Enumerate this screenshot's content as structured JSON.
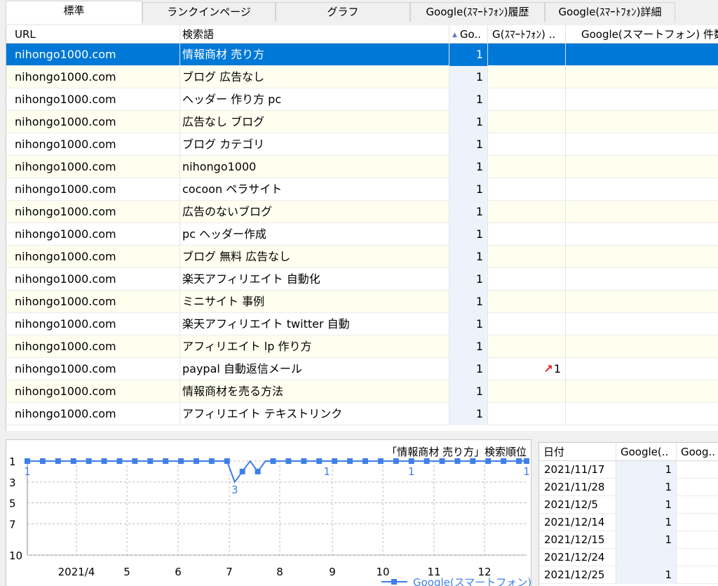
{
  "tabs": [
    {
      "label": "標準",
      "active": true
    },
    {
      "label": "ランクインページ",
      "active": false
    },
    {
      "label": "グラフ",
      "active": false
    },
    {
      "label": "Google(ｽﾏｰﾄﾌｫﾝ)履歴",
      "active": false
    },
    {
      "label": "Google(ｽﾏｰﾄﾌｫﾝ)詳細",
      "active": false
    }
  ],
  "grid": {
    "headers": {
      "url": "URL",
      "keyword": "検索語",
      "google": "Go..",
      "google_sp": "G(ｽﾏｰﾄﾌｫﾝ) ..",
      "count": "Google(スマートフォン) 件数"
    },
    "rows": [
      {
        "url": "nihongo1000.com",
        "keyword": "情報商材 売り方",
        "rank": "1",
        "sp": "",
        "up": false
      },
      {
        "url": "nihongo1000.com",
        "keyword": "ブログ 広告なし",
        "rank": "1",
        "sp": "",
        "up": false
      },
      {
        "url": "nihongo1000.com",
        "keyword": "ヘッダー 作り方 pc",
        "rank": "1",
        "sp": "",
        "up": false
      },
      {
        "url": "nihongo1000.com",
        "keyword": "広告なし ブログ",
        "rank": "1",
        "sp": "",
        "up": false
      },
      {
        "url": "nihongo1000.com",
        "keyword": "ブログ カテゴリ",
        "rank": "1",
        "sp": "",
        "up": false
      },
      {
        "url": "nihongo1000.com",
        "keyword": "nihongo1000",
        "rank": "1",
        "sp": "",
        "up": false
      },
      {
        "url": "nihongo1000.com",
        "keyword": "cocoon ペラサイト",
        "rank": "1",
        "sp": "",
        "up": false
      },
      {
        "url": "nihongo1000.com",
        "keyword": "広告のないブログ",
        "rank": "1",
        "sp": "",
        "up": false
      },
      {
        "url": "nihongo1000.com",
        "keyword": "pc ヘッダー作成",
        "rank": "1",
        "sp": "",
        "up": false
      },
      {
        "url": "nihongo1000.com",
        "keyword": "ブログ 無料 広告なし",
        "rank": "1",
        "sp": "",
        "up": false
      },
      {
        "url": "nihongo1000.com",
        "keyword": "楽天アフィリエイト 自動化",
        "rank": "1",
        "sp": "",
        "up": false
      },
      {
        "url": "nihongo1000.com",
        "keyword": "ミニサイト 事例",
        "rank": "1",
        "sp": "",
        "up": false
      },
      {
        "url": "nihongo1000.com",
        "keyword": "楽天アフィリエイト twitter 自動",
        "rank": "1",
        "sp": "",
        "up": false
      },
      {
        "url": "nihongo1000.com",
        "keyword": "アフィリエイト lp 作り方",
        "rank": "1",
        "sp": "",
        "up": false
      },
      {
        "url": "nihongo1000.com",
        "keyword": "paypal 自動返信メール",
        "rank": "1",
        "sp": "1",
        "up": true
      },
      {
        "url": "nihongo1000.com",
        "keyword": "情報商材を売る方法",
        "rank": "1",
        "sp": "",
        "up": false
      },
      {
        "url": "nihongo1000.com",
        "keyword": "アフィリエイト テキストリンク",
        "rank": "1",
        "sp": "",
        "up": false
      }
    ]
  },
  "chart_data": {
    "type": "line",
    "title": "「情報商材 売り方」検索順位",
    "x_tick_labels": [
      "2021/4",
      "5",
      "6",
      "7",
      "8",
      "9",
      "10",
      "11",
      "12"
    ],
    "y_tick_labels": [
      "1",
      "3",
      "5",
      "7",
      "10"
    ],
    "ylim": [
      10,
      1
    ],
    "series": [
      {
        "name": "Google(スマートフォン)",
        "color": "#3f7fe8",
        "values": [
          1,
          1,
          1,
          1,
          1,
          1,
          1,
          1,
          1,
          1,
          1,
          1,
          1,
          1,
          1,
          1,
          1,
          1,
          1,
          1,
          1,
          1,
          1,
          1,
          1,
          1,
          1,
          3,
          2,
          1,
          2,
          1,
          1,
          1,
          1,
          1,
          1,
          1,
          1,
          1,
          1,
          1,
          1,
          1,
          1,
          1,
          1,
          1,
          1,
          1,
          1,
          1,
          1,
          1,
          1,
          1,
          1,
          1,
          1,
          1,
          1,
          1,
          1,
          1,
          1,
          1
        ]
      }
    ],
    "data_labels": [
      {
        "index": 0,
        "text": "1"
      },
      {
        "index": 27,
        "text": "3"
      },
      {
        "index": 39,
        "text": "1"
      },
      {
        "index": 50,
        "text": "1"
      },
      {
        "index": 65,
        "text": "1"
      }
    ],
    "legend": "bottom-right",
    "grid": true
  },
  "date_table": {
    "headers": {
      "date": "日付",
      "g1": "Google(..",
      "g2": "Goog.."
    },
    "rows": [
      {
        "date": "2021/11/17",
        "g1": "1",
        "g2": ""
      },
      {
        "date": "2021/11/28",
        "g1": "1",
        "g2": ""
      },
      {
        "date": "2021/12/5",
        "g1": "1",
        "g2": ""
      },
      {
        "date": "2021/12/14",
        "g1": "1",
        "g2": ""
      },
      {
        "date": "2021/12/15",
        "g1": "1",
        "g2": ""
      },
      {
        "date": "2021/12/24",
        "g1": "",
        "g2": ""
      },
      {
        "date": "2021/12/25",
        "g1": "1",
        "g2": ""
      }
    ]
  },
  "colors": {
    "selection": "#0078d7",
    "series": "#3f7fe8",
    "rank_up": "#e0201a"
  }
}
